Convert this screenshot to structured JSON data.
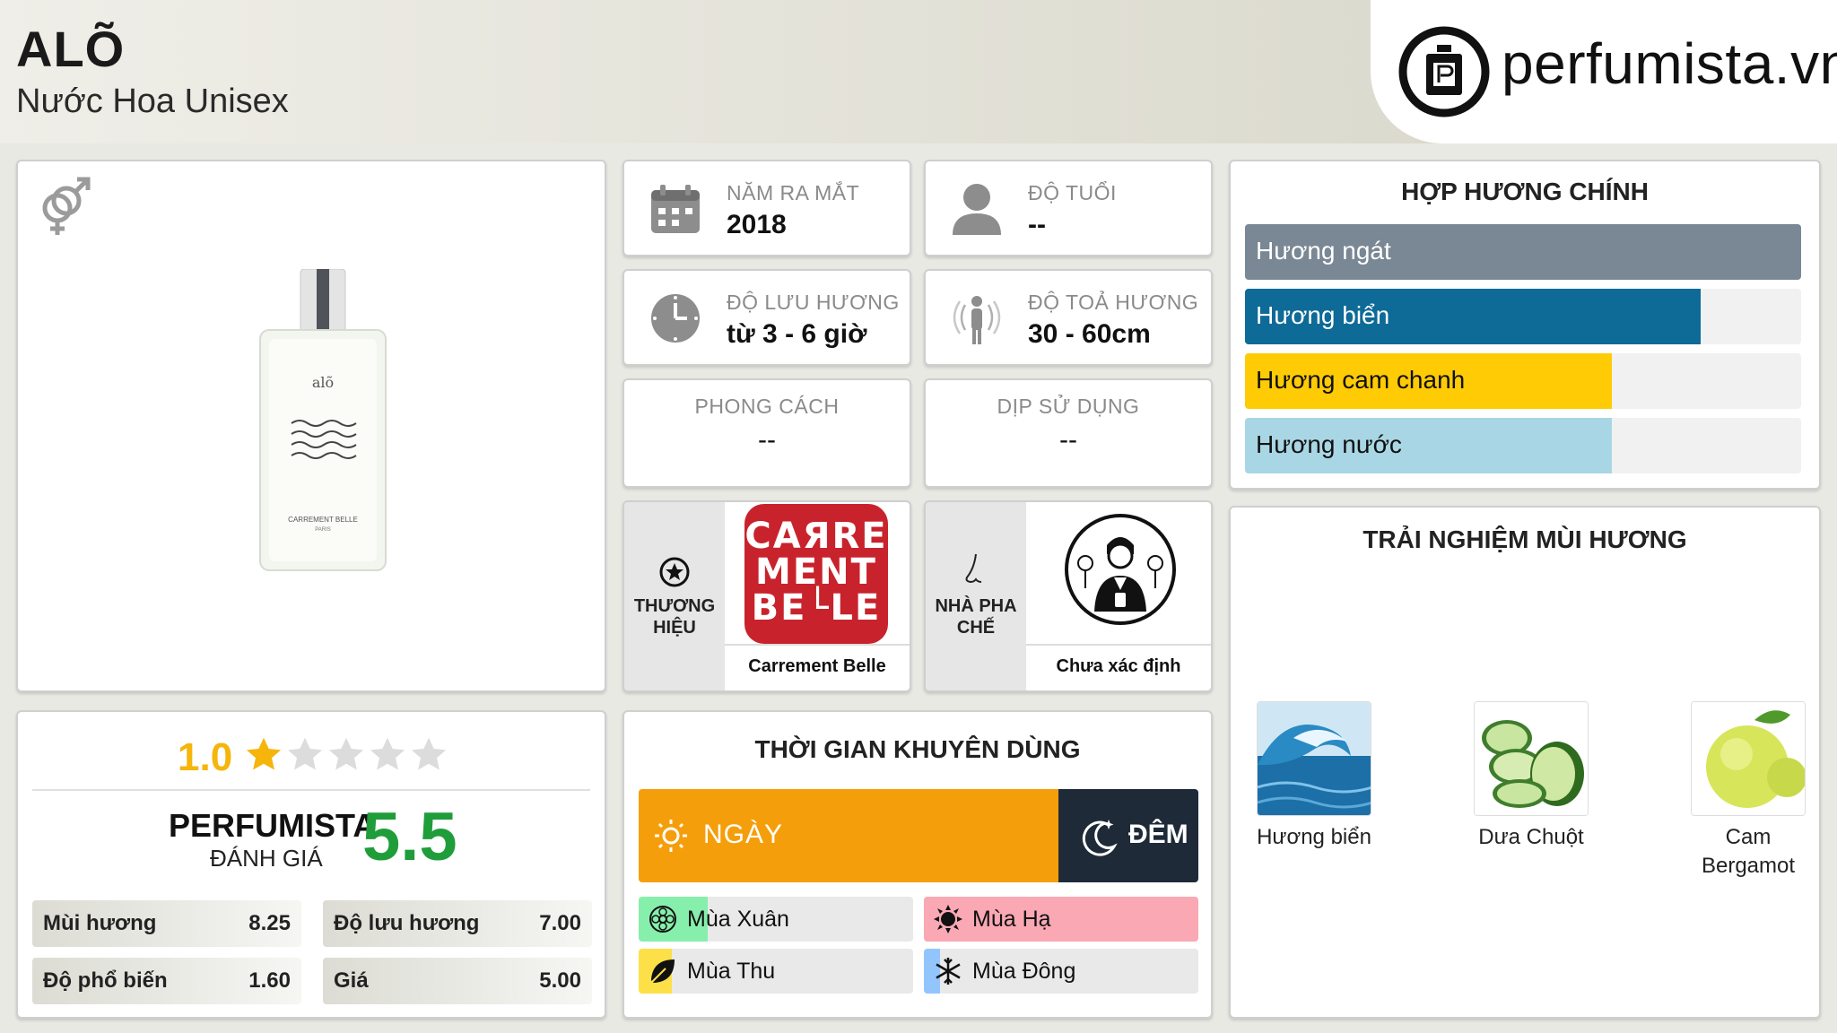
{
  "header": {
    "title": "ALÕ",
    "subtitle": "Nước Hoa Unisex",
    "logo_text": "perfumista.vn"
  },
  "info": {
    "launch_year": {
      "label": "NĂM RA MẮT",
      "value": "2018"
    },
    "age": {
      "label": "ĐỘ TUỔI",
      "value": "--"
    },
    "longevity": {
      "label": "ĐỘ LƯU HƯƠNG",
      "value": "từ 3 - 6 giờ"
    },
    "sillage": {
      "label": "ĐỘ TOẢ HƯƠNG",
      "value": "30 - 60cm"
    },
    "style": {
      "label": "PHONG CÁCH",
      "value": "--"
    },
    "occasion": {
      "label": "DỊP SỬ DỤNG",
      "value": "--"
    },
    "brand": {
      "label_line1": "THƯƠNG",
      "label_line2": "HIỆU",
      "name": "Carrement Belle",
      "logo_line1": "CAЯRE",
      "logo_line2": "MENT",
      "logo_line3": "BE└LE"
    },
    "perfumer": {
      "label_line1": "NHÀ PHA",
      "label_line2": "CHẾ",
      "name": "Chưa xác định"
    }
  },
  "bottle": {
    "brand_text": "alõ",
    "sub_text": "CARREMENT BELLE",
    "city": "PARIS"
  },
  "accords": {
    "title": "HỢP HƯƠNG CHÍNH",
    "items": [
      {
        "label": "Hương ngát",
        "percent": 100,
        "color": "#7a8794",
        "text_dark": false
      },
      {
        "label": "Hương biển",
        "percent": 82,
        "color": "#0e6a96",
        "text_dark": false
      },
      {
        "label": "Hương cam chanh",
        "percent": 66,
        "color": "#ffcb05",
        "text_dark": true
      },
      {
        "label": "Hương nước",
        "percent": 66,
        "color": "#a9d6e5",
        "text_dark": true
      }
    ]
  },
  "notes": {
    "title": "TRẢI NGHIỆM MÙI HƯƠNG",
    "items": [
      {
        "label": "Hương biển"
      },
      {
        "label": "Dưa Chuột"
      },
      {
        "label": "Cam Bergamot",
        "line1": "Cam",
        "line2": "Bergamot"
      }
    ]
  },
  "rating": {
    "user_score": "1.0",
    "stars_filled": 1,
    "stars_total": 5,
    "perfumista_label": "PERFUMISTA",
    "perfumista_sub": "ĐÁNH GIÁ",
    "perfumista_score": "5.5",
    "scores": [
      {
        "label": "Mùi hương",
        "value": "8.25"
      },
      {
        "label": "Độ lưu hương",
        "value": "7.00"
      },
      {
        "label": "Độ phổ biến",
        "value": "1.60"
      },
      {
        "label": "Giá",
        "value": "5.00"
      }
    ]
  },
  "usage": {
    "title": "THỜI GIAN KHUYÊN DÙNG",
    "day_label": "NGÀY",
    "night_label": "ĐÊM",
    "day_percent": 75,
    "day_color": "#f59e0b",
    "night_color": "#1e2a38",
    "seasons": [
      {
        "label": "Mùa Xuân",
        "percent": 25,
        "color": "#86efac"
      },
      {
        "label": "Mùa Hạ",
        "percent": 100,
        "color": "#f9a8b4"
      },
      {
        "label": "Mùa Thu",
        "percent": 12,
        "color": "#fde047"
      },
      {
        "label": "Mùa Đông",
        "percent": 6,
        "color": "#93c5fd"
      }
    ]
  }
}
